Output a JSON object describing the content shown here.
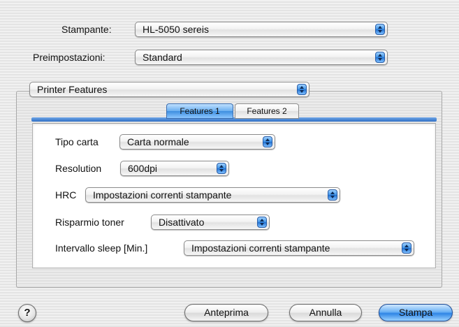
{
  "printer": {
    "label": "Stampante:",
    "value": "HL-5050 sereis"
  },
  "presets": {
    "label": "Preimpostazioni:",
    "value": "Standard"
  },
  "section": {
    "value": "Printer Features"
  },
  "tabs": [
    {
      "label": "Features 1",
      "active": true
    },
    {
      "label": "Features 2",
      "active": false
    }
  ],
  "features": {
    "paper_type": {
      "label": "Tipo carta",
      "value": "Carta normale"
    },
    "resolution": {
      "label": "Resolution",
      "value": "600dpi"
    },
    "hrc": {
      "label": "HRC",
      "value": "Impostazioni correnti stampante"
    },
    "toner_save": {
      "label": "Risparmio toner",
      "value": "Disattivato"
    },
    "sleep": {
      "label": "Intervallo sleep [Min.]",
      "value": "Impostazioni correnti stampante"
    }
  },
  "buttons": {
    "help": "?",
    "preview": "Anteprima",
    "cancel": "Annulla",
    "print": "Stampa"
  },
  "colors": {
    "accent": "#3d8ee0",
    "default_button": "#2f86e6"
  }
}
